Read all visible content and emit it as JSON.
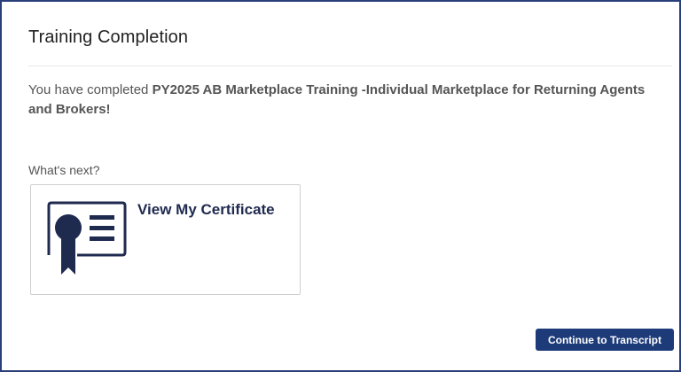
{
  "header": {
    "title": "Training Completion"
  },
  "completion": {
    "prefix": "You have completed ",
    "course_name": "PY2025 AB Marketplace Training -Individual Marketplace for Returning Agents and Brokers!"
  },
  "next_steps": {
    "heading": "What's next?",
    "certificate_card": {
      "label": "View My Certificate",
      "icon": "certificate-icon"
    }
  },
  "actions": {
    "continue_label": "Continue to Transcript"
  },
  "colors": {
    "frame_border": "#2a3f7a",
    "primary_button": "#1d3b78",
    "icon_navy": "#1f2a4f",
    "text_gray": "#555555"
  }
}
